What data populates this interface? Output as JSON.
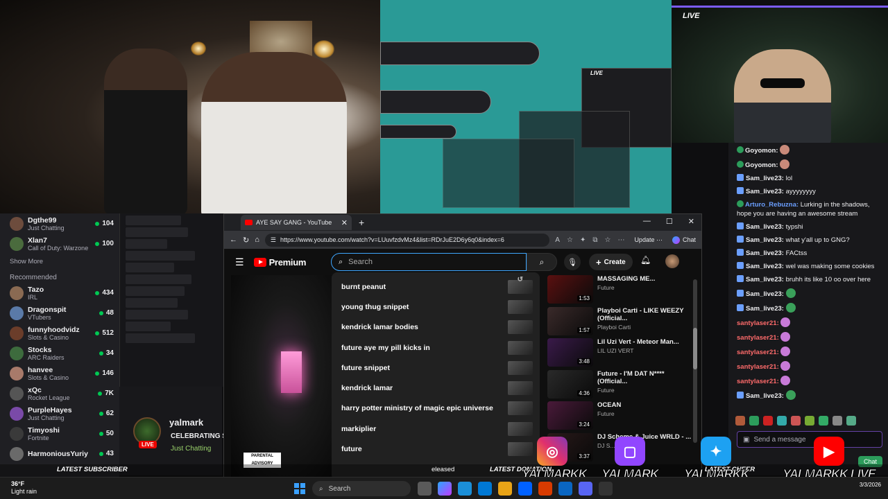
{
  "overlay": {
    "live_tag_right": "LIVE",
    "live_tag_mirror": "LIVE"
  },
  "left_sidebar": {
    "top_channels": [
      {
        "name": "Dgthe99",
        "category": "Just Chatting",
        "viewers": "104"
      },
      {
        "name": "Xlan7",
        "category": "Call of Duty: Warzone",
        "viewers": "100"
      }
    ],
    "show_more": "Show More",
    "recommended_heading": "Recommended",
    "recommended": [
      {
        "name": "Tazo",
        "category": "IRL",
        "viewers": "434"
      },
      {
        "name": "Dragonspit",
        "category": "VTubers",
        "viewers": "48"
      },
      {
        "name": "funnyhoodvidz",
        "category": "Slots & Casino",
        "viewers": "512"
      },
      {
        "name": "Stocks",
        "category": "ARC Raiders",
        "viewers": "34"
      },
      {
        "name": "hanvee",
        "category": "Slots & Casino",
        "viewers": "146"
      },
      {
        "name": "xQc",
        "category": "Rocket League",
        "viewers": "7K"
      },
      {
        "name": "PurpleHayes",
        "category": "Just Chatting",
        "viewers": "62"
      },
      {
        "name": "Timyoshi",
        "category": "Fortnite",
        "viewers": "50"
      },
      {
        "name": "HarmoniousYuriy",
        "category": "",
        "viewers": "43"
      }
    ]
  },
  "streamer_card": {
    "name": "yalmarkk",
    "name_display": "yalmark",
    "celebrating": "CELEBRATING S",
    "category": "Just Chatting",
    "live_label": "LIVE",
    "latest_subscriber_label": "LATEST SUBSCRIBER"
  },
  "browser": {
    "tab_title": "AYE SAY GANG - YouTube",
    "url": "https://www.youtube.com/watch?v=LUuvfzdvMz4&list=RDrJuE2D6y6q0&index=6",
    "update_label": "Update",
    "chat_label": "Chat"
  },
  "youtube": {
    "logo_text": "Premium",
    "search_placeholder": "Search",
    "create_label": "Create",
    "parental_advisory": "PARENTAL ADVISORY",
    "suggestions": [
      "burnt peanut",
      "young thug snippet",
      "kendrick lamar bodies",
      "future aye my pill kicks in",
      "future snippet",
      "kendrick lamar",
      "harry potter ministry of magic epic universe",
      "markiplier",
      "future"
    ],
    "recommendations": [
      {
        "title": "MASSAGING ME...",
        "channel": "Future",
        "duration": "1:53"
      },
      {
        "title": "Playboi Carti - LIKE WEEZY (Official...",
        "channel": "Playboi Carti",
        "duration": "1:57"
      },
      {
        "title": "Lil Uzi Vert - Meteor Man...",
        "channel": "LIL UZI VERT",
        "duration": "3:48"
      },
      {
        "title": "Future - I'M DAT N**** (Official...",
        "channel": "Future",
        "duration": "4:36"
      },
      {
        "title": "OCEAN",
        "channel": "Future",
        "duration": "3:24"
      },
      {
        "title": "DJ Scheme & Juice WRLD - ...",
        "channel": "DJ S...",
        "duration": "3:37"
      }
    ]
  },
  "chat": {
    "messages": [
      {
        "user": "Goyomon:",
        "text": "",
        "color": "#efeff1"
      },
      {
        "user": "Goyomon:",
        "text": "",
        "color": "#efeff1"
      },
      {
        "user": "Sam_live23:",
        "text": "lol",
        "color": "#efeff1"
      },
      {
        "user": "Sam_live23:",
        "text": "ayyyyyyyy",
        "color": "#efeff1"
      },
      {
        "user": "Arturo_Rebuzna:",
        "text": "Lurking in the shadows, hope you are having an awesome stream",
        "color": "#6b9fff"
      },
      {
        "user": "Sam_live23:",
        "text": "typshi",
        "color": "#efeff1"
      },
      {
        "user": "Sam_live23:",
        "text": "what y'all up to GNG?",
        "color": "#efeff1"
      },
      {
        "user": "Sam_live23:",
        "text": "FACtss",
        "color": "#efeff1"
      },
      {
        "user": "Sam_live23:",
        "text": "wel was making some cookies",
        "color": "#efeff1"
      },
      {
        "user": "Sam_live23:",
        "text": "bruhh its like 10 oo over here",
        "color": "#efeff1"
      },
      {
        "user": "Sam_live23:",
        "text": "",
        "color": "#efeff1"
      },
      {
        "user": "Sam_live23:",
        "text": "",
        "color": "#efeff1"
      },
      {
        "user": "santylaser21:",
        "text": "",
        "color": "#ff6b6b"
      },
      {
        "user": "santylaser21:",
        "text": "",
        "color": "#ff6b6b"
      },
      {
        "user": "santylaser21:",
        "text": "",
        "color": "#ff6b6b"
      },
      {
        "user": "santylaser21:",
        "text": "",
        "color": "#ff6b6b"
      },
      {
        "user": "santylaser21:",
        "text": "",
        "color": "#ff6b6b"
      },
      {
        "user": "Sam_live23:",
        "text": "",
        "color": "#efeff1"
      }
    ],
    "input_placeholder": "Send a message",
    "send_label": "Chat"
  },
  "socials": {
    "instagram": "YALMARKK",
    "twitch": "YALMARK",
    "twitter": "YALMARKK",
    "youtube": "YALMARKK LIVE"
  },
  "ticker": {
    "latest_subscriber": "LATEST SUBSCRIBER",
    "latest_donation": "LATEST DONATION",
    "latest_cheer": "LATEST CHEER",
    "released": "eleased"
  },
  "taskbar": {
    "temperature": "36°F",
    "weather": "Light rain",
    "search_label": "Search",
    "date": "3/3/2026"
  }
}
